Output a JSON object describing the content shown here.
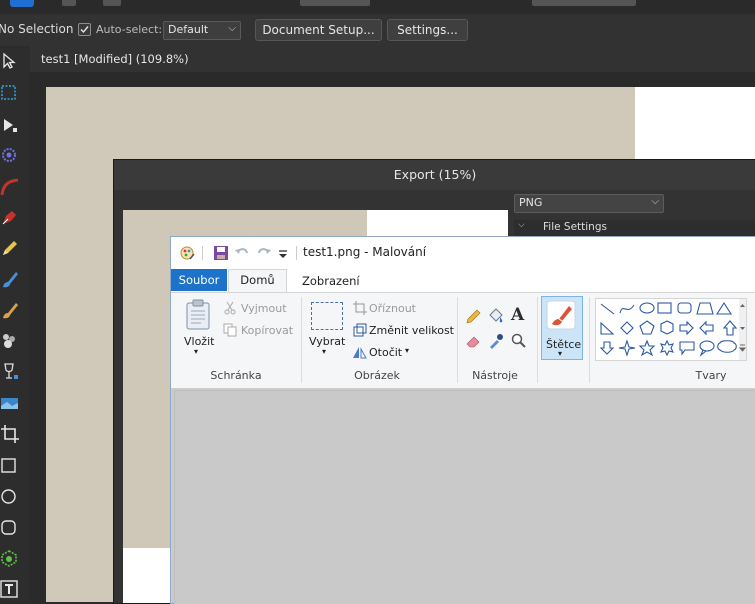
{
  "context_toolbar": {
    "selection_label": "No Selection",
    "auto_select_label": "Auto-select:",
    "auto_select_checked": true,
    "auto_select_value": "Default",
    "document_setup_label": "Document Setup...",
    "settings_label": "Settings..."
  },
  "document_tab": {
    "title": "test1 [Modified] (109.8%)"
  },
  "tools": [
    "move-tool-icon",
    "artboard-tool-icon",
    "node-tool-icon",
    "point-transform-icon",
    "corner-tool-icon",
    "pen-tool-icon",
    "pencil-tool-icon",
    "vector-brush-icon",
    "paint-brush-icon",
    "fill-tool-icon",
    "transparency-tool-icon",
    "place-image-icon",
    "crop-tool-icon",
    "rectangle-tool-icon",
    "ellipse-tool-icon",
    "rounded-rect-icon",
    "shape-tool-icon",
    "artistic-text-icon"
  ],
  "export_dialog": {
    "title": "Export (15%)",
    "format": "PNG",
    "section_label": "File Settings"
  },
  "paint": {
    "title": "test1.png - Malování",
    "tabs": {
      "soubor": "Soubor",
      "domu": "Domů",
      "zobrazeni": "Zobrazení"
    },
    "clipboard": {
      "paste": "Vložit",
      "cut": "Vyjmout",
      "copy": "Kopírovat",
      "group": "Schránka"
    },
    "image": {
      "select": "Vybrat",
      "crop": "Oříznout",
      "resize": "Změnit velikost",
      "rotate": "Otočit",
      "group": "Obrázek"
    },
    "tools_group": "Nástroje",
    "brushes": "Štětce",
    "shapes_group": "Tvary"
  },
  "colors": {
    "affinity_accent": "#1e6fd1",
    "paint_file_tab": "#1c73c9",
    "document_beige": "#d0c9b9"
  }
}
